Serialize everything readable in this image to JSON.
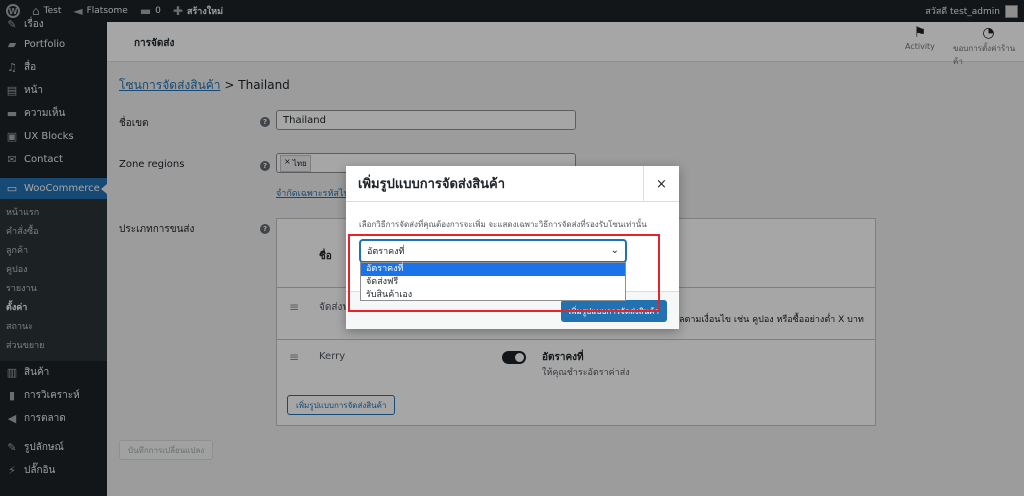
{
  "admin_bar": {
    "site_name": "Test",
    "theme": "Flatsome",
    "comments_count": "0",
    "new_label": "สร้างใหม่",
    "greeting": "สวัสดี test_admin"
  },
  "sidebar": {
    "items_top": [
      {
        "label": "เรื่อง",
        "icon": "pin-icon"
      },
      {
        "label": "Portfolio",
        "icon": "folder-icon"
      },
      {
        "label": "สื่อ",
        "icon": "media-icon"
      },
      {
        "label": "หน้า",
        "icon": "page-icon"
      },
      {
        "label": "ความเห็น",
        "icon": "comment-icon"
      },
      {
        "label": "UX Blocks",
        "icon": "blocks-icon"
      },
      {
        "label": "Contact",
        "icon": "mail-icon"
      }
    ],
    "active_item": "WooCommerce",
    "submenu": [
      "หน้าแรก",
      "คำสั่งซื้อ",
      "ลูกค้า",
      "คูปอง",
      "รายงาน",
      "ตั้งค่า",
      "สถานะ",
      "ส่วนขยาย"
    ],
    "submenu_current": "ตั้งค่า",
    "items_bottom": [
      {
        "label": "สินค้า",
        "icon": "product-icon"
      },
      {
        "label": "การวิเคราะห์",
        "icon": "analytics-icon"
      },
      {
        "label": "การตลาด",
        "icon": "megaphone-icon"
      },
      {
        "label": "รูปลักษณ์",
        "icon": "brush-icon"
      },
      {
        "label": "ปลั๊กอิน",
        "icon": "plugin-icon"
      }
    ]
  },
  "header": {
    "title": "การจัดส่ง",
    "activity_label": "Activity",
    "setup_label": "ขอบการตั้งค่าร้านค้า"
  },
  "page": {
    "breadcrumb_link": "โซนการจัดส่งสินค้า",
    "breadcrumb_sep": ">",
    "breadcrumb_current": "Thailand",
    "zone_name_label": "ชื่อเขต",
    "zone_name_value": "Thailand",
    "zone_regions_label": "Zone regions",
    "region_token": "ไทย",
    "region_link": "จำกัดเฉพาะรหัสไปรษณีย์",
    "shipping_methods_label": "ประเภทการขนส่ง",
    "table_header": "ชื่อ",
    "row1_name": "จัดส่งฟรี",
    "row1_desc": "ลตามเงื่อนไข เช่น คูปอง หรือซื้ออย่างต่ำ X บาท",
    "row2_name": "Kerry",
    "row2_title": "อัตราคงที่",
    "row2_desc": "ให้คุณชำระอัตราค่าส่ง",
    "add_method_button": "เพิ่มรูปแบบการจัดส่งสินค้า",
    "save_button": "บันทึกการเปลี่ยนแปลง"
  },
  "modal": {
    "title": "เพิ่มรูปแบบการจัดส่งสินค้า",
    "close": "×",
    "description": "เลือกวิธีการจัดส่งที่คุณต้องการจะเพิ่ม จะแสดงเฉพาะวิธีการจัดส่งที่รองรับโซนเท่านั้น",
    "select_value": "อัตราคงที่",
    "options": [
      "อัตราคงที่",
      "จัดส่งฟรี",
      "รับสินค้าเอง"
    ],
    "selected_index": 0,
    "submit_button": "เพิ่มรูปแบบการจัดส่งสินค้า"
  },
  "colors": {
    "admin_dark": "#1d2327",
    "wp_blue": "#2271b1",
    "option_highlight": "#1a73e8",
    "annotation_red": "#e3242b"
  }
}
